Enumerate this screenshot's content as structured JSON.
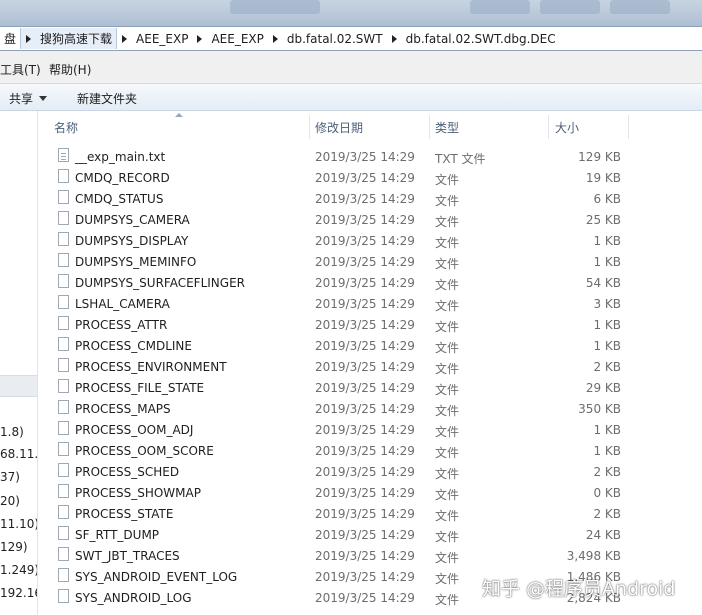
{
  "address_bar": {
    "crumbs": [
      "盘",
      "搜狗高速下载",
      "AEE_EXP",
      "AEE_EXP",
      "db.fatal.02.SWT",
      "db.fatal.02.SWT.dbg.DEC"
    ]
  },
  "menu": {
    "tools": "工具(T)",
    "help": "帮助(H)"
  },
  "command_bar": {
    "share": "共享",
    "new_folder": "新建文件夹"
  },
  "nav_pane": {
    "network_items": [
      "1.8)",
      "68.11.",
      "37)",
      "20)",
      "11.10)",
      "129)",
      "1.249)",
      "192.16"
    ]
  },
  "columns": {
    "name": "名称",
    "date": "修改日期",
    "type": "类型",
    "size": "大小"
  },
  "files": [
    {
      "name": "__exp_main.txt",
      "date": "2019/3/25 14:29",
      "type": "TXT 文件",
      "size": "129 KB",
      "icon": "text-file-icon"
    },
    {
      "name": "CMDQ_RECORD",
      "date": "2019/3/25 14:29",
      "type": "文件",
      "size": "19 KB",
      "icon": "file-icon"
    },
    {
      "name": "CMDQ_STATUS",
      "date": "2019/3/25 14:29",
      "type": "文件",
      "size": "6 KB",
      "icon": "file-icon"
    },
    {
      "name": "DUMPSYS_CAMERA",
      "date": "2019/3/25 14:29",
      "type": "文件",
      "size": "25 KB",
      "icon": "file-icon"
    },
    {
      "name": "DUMPSYS_DISPLAY",
      "date": "2019/3/25 14:29",
      "type": "文件",
      "size": "1 KB",
      "icon": "file-icon"
    },
    {
      "name": "DUMPSYS_MEMINFO",
      "date": "2019/3/25 14:29",
      "type": "文件",
      "size": "1 KB",
      "icon": "file-icon"
    },
    {
      "name": "DUMPSYS_SURFACEFLINGER",
      "date": "2019/3/25 14:29",
      "type": "文件",
      "size": "54 KB",
      "icon": "file-icon"
    },
    {
      "name": "LSHAL_CAMERA",
      "date": "2019/3/25 14:29",
      "type": "文件",
      "size": "3 KB",
      "icon": "file-icon"
    },
    {
      "name": "PROCESS_ATTR",
      "date": "2019/3/25 14:29",
      "type": "文件",
      "size": "1 KB",
      "icon": "file-icon"
    },
    {
      "name": "PROCESS_CMDLINE",
      "date": "2019/3/25 14:29",
      "type": "文件",
      "size": "1 KB",
      "icon": "file-icon"
    },
    {
      "name": "PROCESS_ENVIRONMENT",
      "date": "2019/3/25 14:29",
      "type": "文件",
      "size": "2 KB",
      "icon": "file-icon"
    },
    {
      "name": "PROCESS_FILE_STATE",
      "date": "2019/3/25 14:29",
      "type": "文件",
      "size": "29 KB",
      "icon": "file-icon"
    },
    {
      "name": "PROCESS_MAPS",
      "date": "2019/3/25 14:29",
      "type": "文件",
      "size": "350 KB",
      "icon": "file-icon"
    },
    {
      "name": "PROCESS_OOM_ADJ",
      "date": "2019/3/25 14:29",
      "type": "文件",
      "size": "1 KB",
      "icon": "file-icon"
    },
    {
      "name": "PROCESS_OOM_SCORE",
      "date": "2019/3/25 14:29",
      "type": "文件",
      "size": "1 KB",
      "icon": "file-icon"
    },
    {
      "name": "PROCESS_SCHED",
      "date": "2019/3/25 14:29",
      "type": "文件",
      "size": "2 KB",
      "icon": "file-icon"
    },
    {
      "name": "PROCESS_SHOWMAP",
      "date": "2019/3/25 14:29",
      "type": "文件",
      "size": "0 KB",
      "icon": "file-icon"
    },
    {
      "name": "PROCESS_STATE",
      "date": "2019/3/25 14:29",
      "type": "文件",
      "size": "2 KB",
      "icon": "file-icon"
    },
    {
      "name": "SF_RTT_DUMP",
      "date": "2019/3/25 14:29",
      "type": "文件",
      "size": "24 KB",
      "icon": "file-icon"
    },
    {
      "name": "SWT_JBT_TRACES",
      "date": "2019/3/25 14:29",
      "type": "文件",
      "size": "3,498 KB",
      "icon": "file-icon"
    },
    {
      "name": "SYS_ANDROID_EVENT_LOG",
      "date": "2019/3/25 14:29",
      "type": "文件",
      "size": "1,486 KB",
      "icon": "file-icon"
    },
    {
      "name": "SYS_ANDROID_LOG",
      "date": "2019/3/25 14:29",
      "type": "文件",
      "size": "2,824 KB",
      "icon": "file-icon"
    }
  ],
  "watermark": "知乎 @程序员Android"
}
